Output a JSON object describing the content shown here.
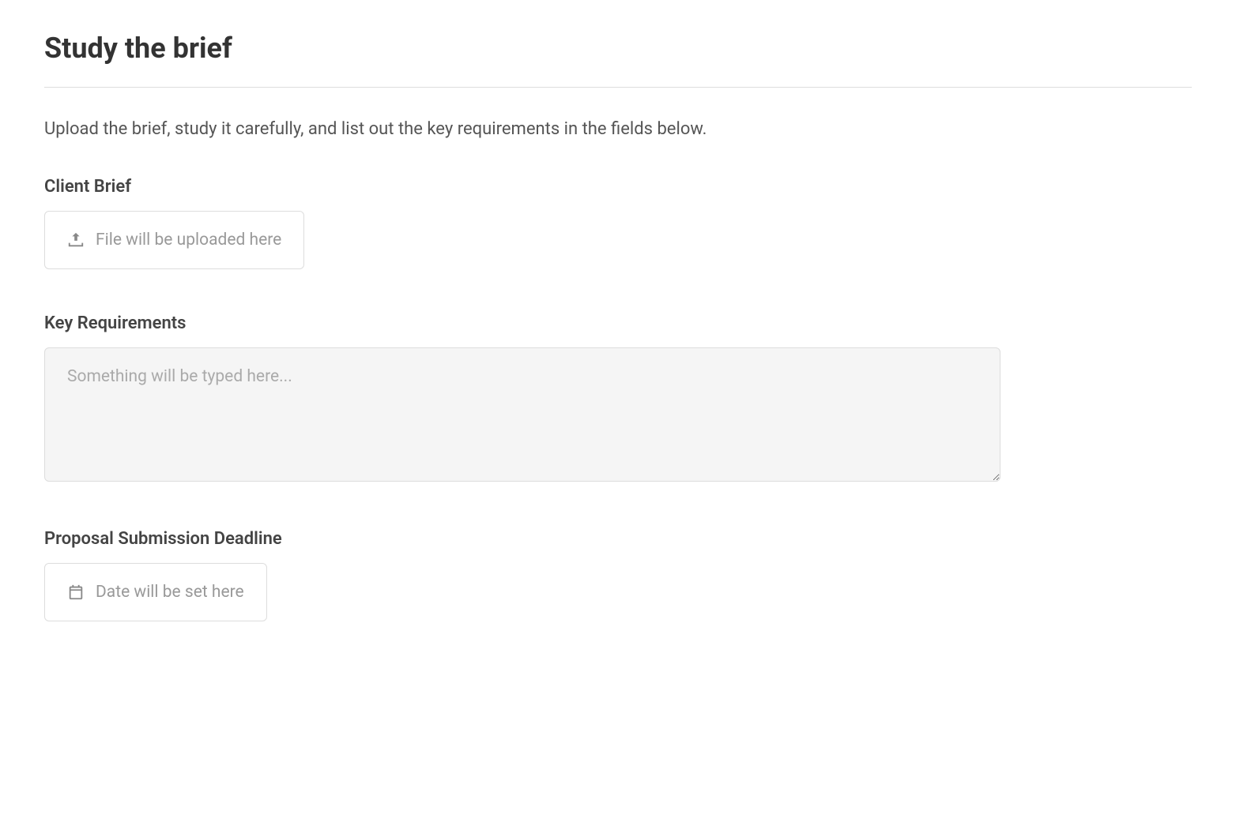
{
  "page": {
    "title": "Study the brief",
    "description": "Upload the brief, study it carefully, and list out the key requirements in the fields below."
  },
  "fields": {
    "client_brief": {
      "label": "Client Brief",
      "placeholder": "File will be uploaded here"
    },
    "key_requirements": {
      "label": "Key Requirements",
      "placeholder": "Something will be typed here..."
    },
    "deadline": {
      "label": "Proposal Submission Deadline",
      "placeholder": "Date will be set here"
    }
  }
}
